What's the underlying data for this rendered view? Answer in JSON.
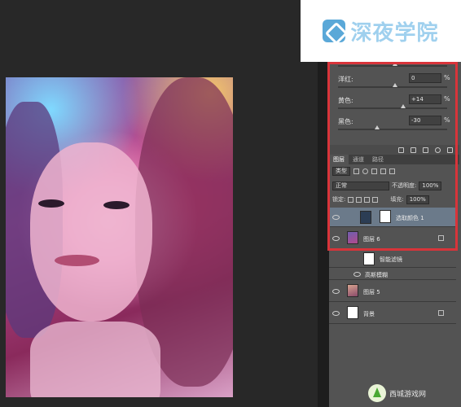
{
  "logo": {
    "text": "深夜学院",
    "icon": "logo-mark-icon"
  },
  "properties": {
    "rows": [
      {
        "label": "洋红:",
        "value": "0",
        "unit": "%"
      },
      {
        "label": "黄色:",
        "value": "+14",
        "unit": "%"
      },
      {
        "label": "黑色:",
        "value": "-30",
        "unit": "%"
      }
    ]
  },
  "layers_panel": {
    "tabs": [
      "图层",
      "通道",
      "路径"
    ],
    "filter_kind": "类型",
    "blend_mode": "正常",
    "opacity_label": "不透明度:",
    "opacity_value": "100%",
    "lock_label": "锁定:",
    "fill_label": "填充:",
    "fill_value": "100%",
    "layers": [
      {
        "name": "选取颜色 1",
        "type": "adjustment"
      },
      {
        "name": "图层 6",
        "type": "smart-object"
      },
      {
        "name": "智能滤镜",
        "type": "filter-mask"
      },
      {
        "name": "高斯模糊",
        "type": "filter"
      },
      {
        "name": "图层 5",
        "type": "pixel"
      },
      {
        "name": "背景",
        "type": "background"
      }
    ]
  },
  "watermark": {
    "text": "西城游戏网"
  },
  "colors": {
    "highlight": "#d8343a",
    "panel": "#535353",
    "canvas": "#282828"
  }
}
